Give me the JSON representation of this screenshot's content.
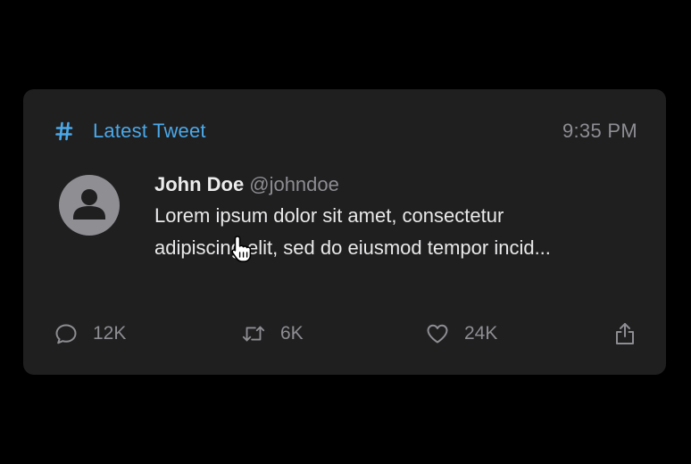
{
  "card": {
    "header_icon": "hash-icon",
    "header_title": "Latest Tweet",
    "time": "9:35 PM",
    "accent_color": "#4aa8e8"
  },
  "tweet": {
    "avatar_icon": "user-avatar-icon",
    "author_name": "John Doe",
    "author_handle": "@johndoe",
    "text_line_1": "Lorem ipsum dolor sit amet, consectetur",
    "text_line_2": "adipiscing elit, sed do eiusmod tempor incid..."
  },
  "actions": {
    "reply": {
      "icon": "reply-icon",
      "count": "12K"
    },
    "retweet": {
      "icon": "retweet-icon",
      "count": "6K"
    },
    "like": {
      "icon": "heart-icon",
      "count": "24K"
    },
    "share": {
      "icon": "share-icon"
    }
  },
  "cursor": {
    "icon": "hand-pointer-icon"
  }
}
